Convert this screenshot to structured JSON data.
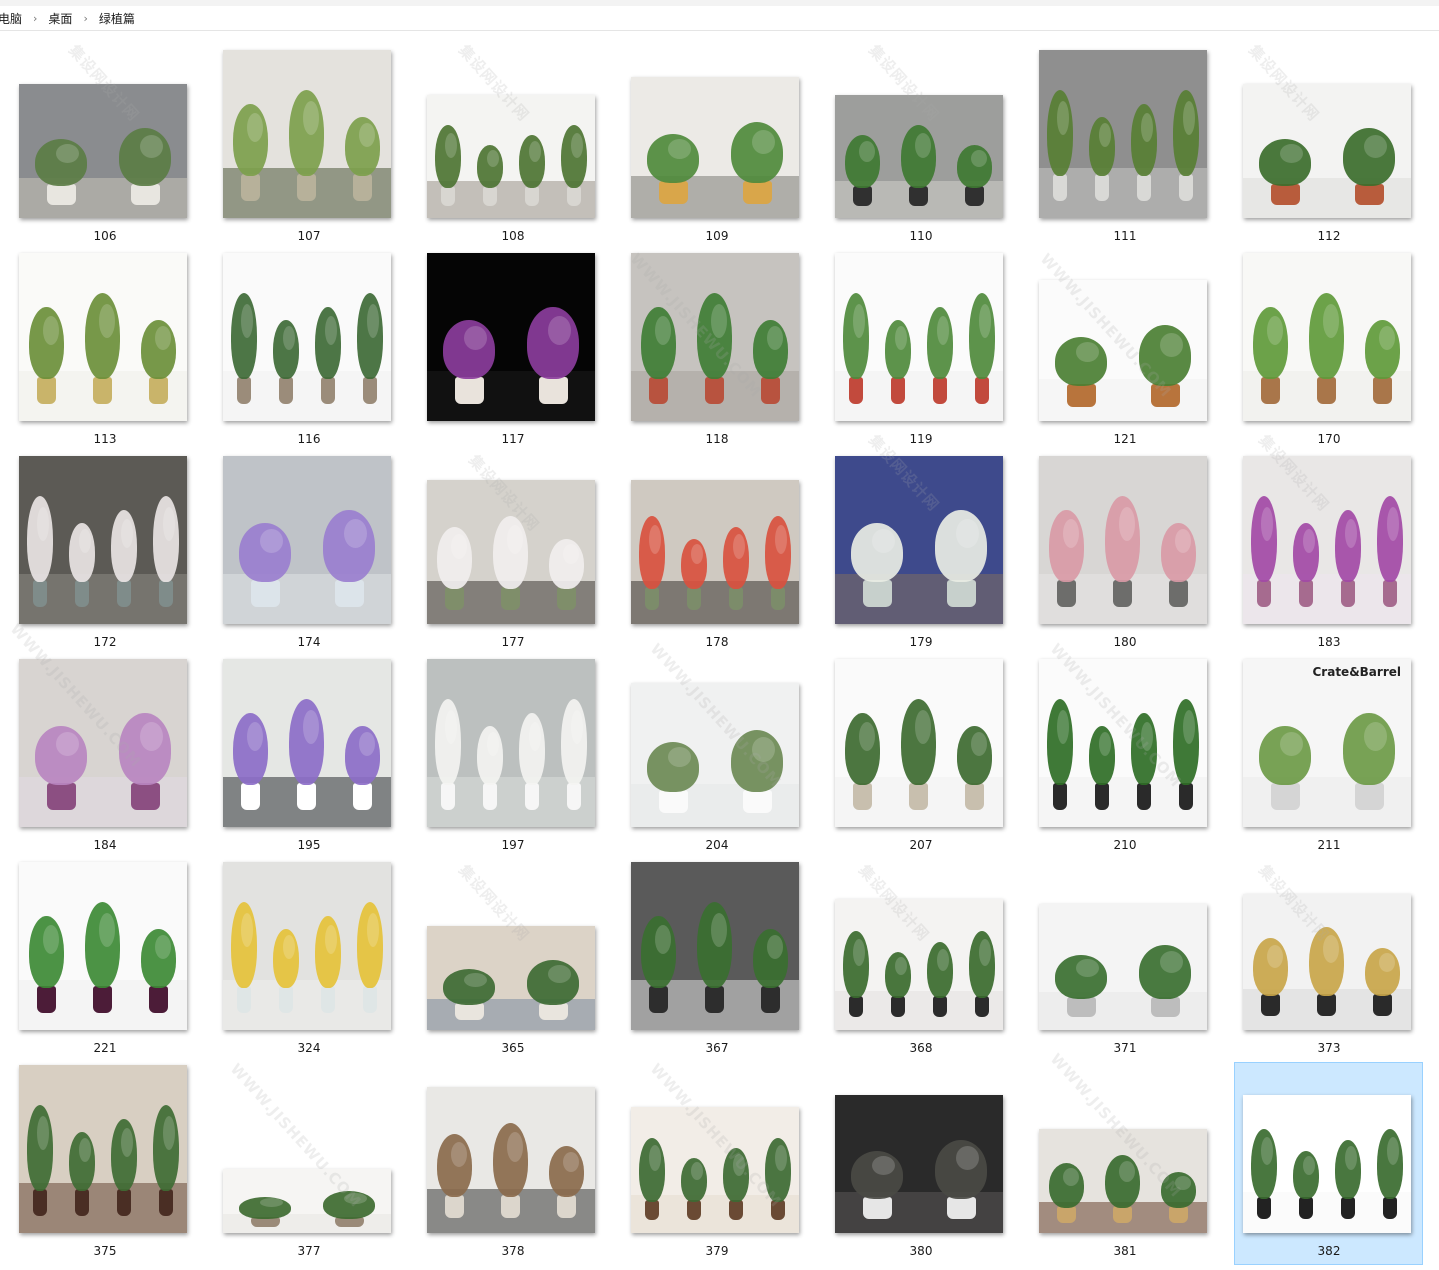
{
  "breadcrumb": {
    "items": [
      "电脑",
      "桌面",
      "绿植篇"
    ]
  },
  "watermark": {
    "site_cn": "集设网设计网",
    "site_url": "WWW.JISHEWU.COM"
  },
  "colors": {
    "selection_bg": "#cce8ff",
    "selection_border": "#99d1ff"
  },
  "thumbnails": [
    {
      "label": "106",
      "bg": "#8a8c8f",
      "floor": "#c7c2b8",
      "plant": "#5b7d45",
      "pot": "#e8e6e0"
    },
    {
      "label": "107",
      "bg": "#e4e2dd",
      "floor": "#4e5a3d",
      "plant": "#7da04c",
      "pot": "#b7b19a"
    },
    {
      "label": "108",
      "bg": "#f4f4f2",
      "floor": "#9a938b",
      "plant": "#4d7433",
      "pot": "#d8d6d1"
    },
    {
      "label": "109",
      "bg": "#eceae6",
      "floor": "#7d7b77",
      "plant": "#4f8a3c",
      "pot": "#d9a64a"
    },
    {
      "label": "110",
      "bg": "#9d9e9c",
      "floor": "#cfcfcb",
      "plant": "#3f7a32",
      "pot": "#303030"
    },
    {
      "label": "111",
      "bg": "#8f8f8f",
      "floor": "#c6c6c4",
      "plant": "#587f34",
      "pot": "#d9d9d6"
    },
    {
      "label": "112",
      "bg": "#f3f3f2",
      "floor": "#dcdcdb",
      "plant": "#3c6e2d",
      "pot": "#b85c3c"
    },
    {
      "label": "113",
      "bg": "#fafaf8",
      "floor": "#eeeeea",
      "plant": "#6b8f3a",
      "pot": "#c9b46a"
    },
    {
      "label": "116",
      "bg": "#fafafa",
      "floor": "#f0f0f0",
      "plant": "#3e6a36",
      "pot": "#9b8c7a"
    },
    {
      "label": "117",
      "bg": "#050505",
      "floor": "#1b1b1b",
      "plant": "#8b3d9c",
      "pot": "#e9e3dc"
    },
    {
      "label": "118",
      "bg": "#c6c3bf",
      "floor": "#a7a29c",
      "plant": "#3f7e35",
      "pot": "#b8533f"
    },
    {
      "label": "119",
      "bg": "#fbfbfb",
      "floor": "#f0f0f0",
      "plant": "#4f8a3c",
      "pot": "#c24a3d"
    },
    {
      "label": "121",
      "bg": "#fbfbfb",
      "floor": "#f2f2f2",
      "plant": "#4b7f33",
      "pot": "#b8743c"
    },
    {
      "label": "170",
      "bg": "#f8f8f6",
      "floor": "#ececea",
      "plant": "#5f9a3a",
      "pot": "#a9764a"
    },
    {
      "label": "172",
      "bg": "#5c5a55",
      "floor": "#8c8a84",
      "plant": "#e9e4e4",
      "pot": "#7f8c8a"
    },
    {
      "label": "174",
      "bg": "#bfc3c8",
      "floor": "#dee1e4",
      "plant": "#9a7fcf",
      "pot": "#dce4ea"
    },
    {
      "label": "177",
      "bg": "#d5d2cc",
      "floor": "#3f3a36",
      "plant": "#f1eeee",
      "pot": "#7f8e6a"
    },
    {
      "label": "178",
      "bg": "#cfc9c1",
      "floor": "#3a3532",
      "plant": "#d9513f",
      "pot": "#7c8c6a"
    },
    {
      "label": "179",
      "bg": "#3e4a8c",
      "floor": "#7d6d60",
      "plant": "#e8ebe4",
      "pot": "#c7d0cc"
    },
    {
      "label": "180",
      "bg": "#d8d6d4",
      "floor": "#e8e6e4",
      "plant": "#d99aa6",
      "pot": "#6d6d6b"
    },
    {
      "label": "183",
      "bg": "#e9e7e6",
      "floor": "#efe6ee",
      "plant": "#a24aa6",
      "pot": "#a66b8f"
    },
    {
      "label": "184",
      "bg": "#d8d4d1",
      "floor": "#e2d9e3",
      "plant": "#b986c0",
      "pot": "#8c4f82"
    },
    {
      "label": "195",
      "bg": "#e5e7e4",
      "floor": "#2d3135",
      "plant": "#8c6ec8",
      "pot": "#ffffff"
    },
    {
      "label": "197",
      "bg": "#bcc0bf",
      "floor": "#d9dcdb",
      "plant": "#f3f3f1",
      "pot": "#f6f6f6"
    },
    {
      "label": "204",
      "bg": "#f0f1f1",
      "floor": "#e6e7e7",
      "plant": "#6d8a55",
      "pot": "#fafafa"
    },
    {
      "label": "207",
      "bg": "#fafafa",
      "floor": "#f0f0f0",
      "plant": "#3d6a30",
      "pot": "#c8bfae"
    },
    {
      "label": "210",
      "bg": "#fbfbfb",
      "floor": "#f0f0f0",
      "plant": "#2f6e26",
      "pot": "#2a2a2a"
    },
    {
      "label": "211",
      "bg": "#f6f6f6",
      "floor": "#ebebeb",
      "plant": "#6c9a47",
      "pot": "#d5d5d5",
      "brand": "Crate&Barrel"
    },
    {
      "label": "221",
      "bg": "#fafafa",
      "floor": "#efefef",
      "plant": "#3d8a35",
      "pot": "#4c1c38"
    },
    {
      "label": "324",
      "bg": "#e2e2e0",
      "floor": "#efefed",
      "plant": "#e5c23a",
      "pot": "#dfe6e6"
    },
    {
      "label": "365",
      "bg": "#dcd3c7",
      "floor": "#7b8ca0",
      "plant": "#3d6a33",
      "pot": "#e9e5de"
    },
    {
      "label": "367",
      "bg": "#5a5a5a",
      "floor": "#dcdcdc",
      "plant": "#3a6f30",
      "pot": "#2d2d2d"
    },
    {
      "label": "368",
      "bg": "#f4f3f2",
      "floor": "#e3e0e0",
      "plant": "#3a6b2e",
      "pot": "#2b2b2b"
    },
    {
      "label": "371",
      "bg": "#f4f4f4",
      "floor": "#e8e8e8",
      "plant": "#3a6f30",
      "pot": "#bdbdbd"
    },
    {
      "label": "373",
      "bg": "#f2f2f2",
      "floor": "#d9d9d9",
      "plant": "#c9a64a",
      "pot": "#2a2a2a"
    },
    {
      "label": "375",
      "bg": "#d8cfc2",
      "floor": "#6a4a3a",
      "plant": "#3f6c34",
      "pot": "#4a2e24"
    },
    {
      "label": "377",
      "bg": "#f6f5f3",
      "floor": "#e8e6e2",
      "plant": "#3d6a30",
      "pot": "#9a8a78"
    },
    {
      "label": "378",
      "bg": "#e9e8e5",
      "floor": "#3a3a3a",
      "plant": "#8a6a4c",
      "pot": "#dcd6cc"
    },
    {
      "label": "379",
      "bg": "#f2ede7",
      "floor": "#e6dccf",
      "plant": "#3d6a33",
      "pot": "#6a4a34"
    },
    {
      "label": "380",
      "bg": "#2a2a2a",
      "floor": "#5a5656",
      "plant": "#4a4a44",
      "pot": "#e6e6e6"
    },
    {
      "label": "381",
      "bg": "#e6e3de",
      "floor": "#6a4632",
      "plant": "#3a6b2f",
      "pot": "#c9a56a"
    },
    {
      "label": "382",
      "bg": "#ffffff",
      "floor": "#f7f7f7",
      "plant": "#3a6b2f",
      "pot": "#222222",
      "selected": true
    }
  ]
}
